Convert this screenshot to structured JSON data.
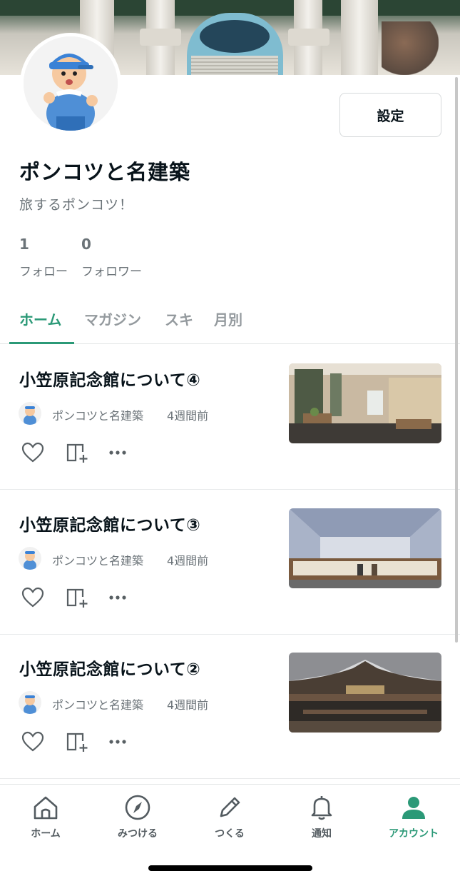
{
  "profile": {
    "name": "ポンコツと名建築",
    "bio": "旅するポンコツ！",
    "settings_label": "設定",
    "following_count": "1",
    "following_label": "フォロー",
    "followers_count": "0",
    "followers_label": "フォロワー"
  },
  "tabs": [
    {
      "label": "ホーム",
      "active": true
    },
    {
      "label": "マガジン",
      "active": false
    },
    {
      "label": "スキ",
      "active": false
    },
    {
      "label": "月別",
      "active": false
    }
  ],
  "articles": [
    {
      "title": "小笠原記念館について④",
      "author": "ポンコツと名建築",
      "time": "4週間前"
    },
    {
      "title": "小笠原記念館について③",
      "author": "ポンコツと名建築",
      "time": "4週間前"
    },
    {
      "title": "小笠原記念館について②",
      "author": "ポンコツと名建築",
      "time": "4週間前"
    }
  ],
  "bottom_nav": [
    {
      "label": "ホーム",
      "icon": "home-icon",
      "active": false
    },
    {
      "label": "みつける",
      "icon": "compass-icon",
      "active": false
    },
    {
      "label": "つくる",
      "icon": "pencil-icon",
      "active": false
    },
    {
      "label": "通知",
      "icon": "bell-icon",
      "active": false
    },
    {
      "label": "アカウント",
      "icon": "person-icon",
      "active": true
    }
  ],
  "colors": {
    "accent": "#2b9977",
    "text": "#08131a",
    "muted": "#6b7378"
  }
}
